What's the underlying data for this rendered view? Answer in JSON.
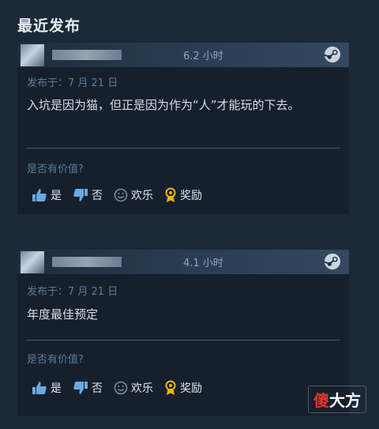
{
  "section_title": "最近发布",
  "reviews": [
    {
      "hours": "6.2 小时",
      "posted": "发布于：7 月 21 日",
      "text": "入坑是因为猫，但正是因为作为“人”才能玩的下去。",
      "helpful_prompt": "是否有价值?",
      "vote_yes": "是",
      "vote_no": "否",
      "vote_funny": "欢乐",
      "vote_award": "奖励"
    },
    {
      "hours": "4.1 小时",
      "posted": "发布于：7 月 21 日",
      "text": "年度最佳预定",
      "helpful_prompt": "是否有价值?",
      "vote_yes": "是",
      "vote_no": "否",
      "vote_funny": "欢乐",
      "vote_award": "奖励"
    }
  ],
  "watermark": {
    "first": "傻",
    "rest": "大方"
  },
  "colors": {
    "background": "#1b2838",
    "card": "#16202d",
    "award_icon": "#f0b21b",
    "thumb_icon": "#6aa8e0"
  }
}
